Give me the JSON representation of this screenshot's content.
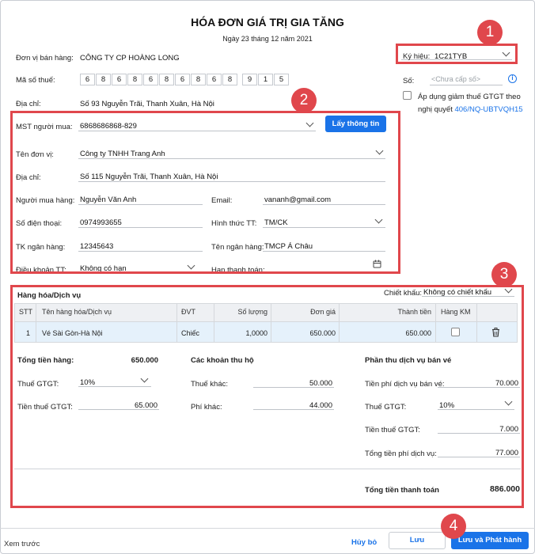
{
  "header": {
    "title": "HÓA ĐƠN GIÁ TRỊ GIA TĂNG",
    "date": "Ngày 23 tháng 12 năm 2021"
  },
  "seller": {
    "name_label": "Đơn vị bán hàng:",
    "name": "CÔNG TY CP HOÀNG LONG",
    "tax_label": "Mã số thuế:",
    "tax_digits": [
      "6",
      "8",
      "6",
      "8",
      "6",
      "8",
      "6",
      "8",
      "6",
      "8"
    ],
    "tax_suffix": [
      "9",
      "1",
      "5"
    ],
    "address_label": "Địa chỉ:",
    "address": "Số 93 Nguyễn Trãi, Thanh Xuân, Hà Nội"
  },
  "invoice": {
    "symbol_label": "Ký hiệu:",
    "symbol": "1C21TYB",
    "number_label": "Số:",
    "number_placeholder": "<Chưa cấp số>",
    "apply_label_1": "Áp dụng giảm thuế GTGT theo",
    "apply_label_2": "nghị quyết",
    "apply_link": "406/NQ-UBTVQH15"
  },
  "buyer": {
    "mst_label": "MST người mua:",
    "mst": "6868686868-829",
    "fetch_button": "Lấy thông tin",
    "unit_label": "Tên đơn vị:",
    "unit": "Công ty TNHH Trang Anh",
    "address_label": "Địa chỉ:",
    "address": "Số 115 Nguyễn Trãi, Thanh Xuân, Hà Nội",
    "person_label": "Người mua hàng:",
    "person": "Nguyễn Văn Anh",
    "email_label": "Email:",
    "email": "vananh@gmail.com",
    "phone_label": "Số điện thoại:",
    "phone": "0974993655",
    "payment_label": "Hình thức TT:",
    "payment": "TM/CK",
    "bank_acc_label": "TK ngân hàng:",
    "bank_acc": "12345643",
    "bank_name_label": "Tên ngân hàng:",
    "bank_name": "TMCP Á Châu",
    "terms_label": "Điều khoản TT:",
    "terms": "Không có hạn",
    "due_label": "Hạn thanh toán:"
  },
  "goods": {
    "section_title": "Hàng hóa/Dịch vụ",
    "discount_label": "Chiết khấu:",
    "discount": "Không có chiết khấu",
    "columns": [
      "STT",
      "Tên hàng hóa/Dịch vụ",
      "ĐVT",
      "Số lượng",
      "Đơn giá",
      "Thành tiền",
      "Hàng KM"
    ],
    "rows": [
      {
        "stt": "1",
        "name": "Vé Sài Gòn-Hà Nội",
        "unit": "Chiếc",
        "qty": "1,0000",
        "price": "650.000",
        "total": "650.000"
      }
    ]
  },
  "totals": {
    "goods_label": "Tổng tiền hàng:",
    "goods_value": "650.000",
    "vat_label": "Thuế GTGT:",
    "vat_value": "10%",
    "vat_amount_label": "Tiền thuế GTGT:",
    "vat_amount": "65.000",
    "collect_title": "Các khoản thu hộ",
    "other_tax_label": "Thuế khác:",
    "other_tax": "50.000",
    "other_fee_label": "Phí khác:",
    "other_fee": "44.000",
    "service_title": "Phần thu dịch vụ bán vé",
    "service_fee_label": "Tiền phí dịch vụ bán vé:",
    "service_fee": "70.000",
    "service_vat_label": "Thuế GTGT:",
    "service_vat": "10%",
    "service_vat_amount_label": "Tiền thuế GTGT:",
    "service_vat_amount": "7.000",
    "service_total_label": "Tổng tiền phí dịch vụ:",
    "service_total": "77.000",
    "grand_label": "Tổng tiền thanh toán",
    "grand_value": "886.000"
  },
  "footer": {
    "preview": "Xem trước",
    "cancel": "Hủy bỏ",
    "save": "Lưu",
    "save_publish": "Lưu và Phát hành"
  },
  "badges": [
    "1",
    "2",
    "3",
    "4"
  ],
  "colors": {
    "accent": "#1a73e8",
    "highlight": "#e0474c"
  }
}
